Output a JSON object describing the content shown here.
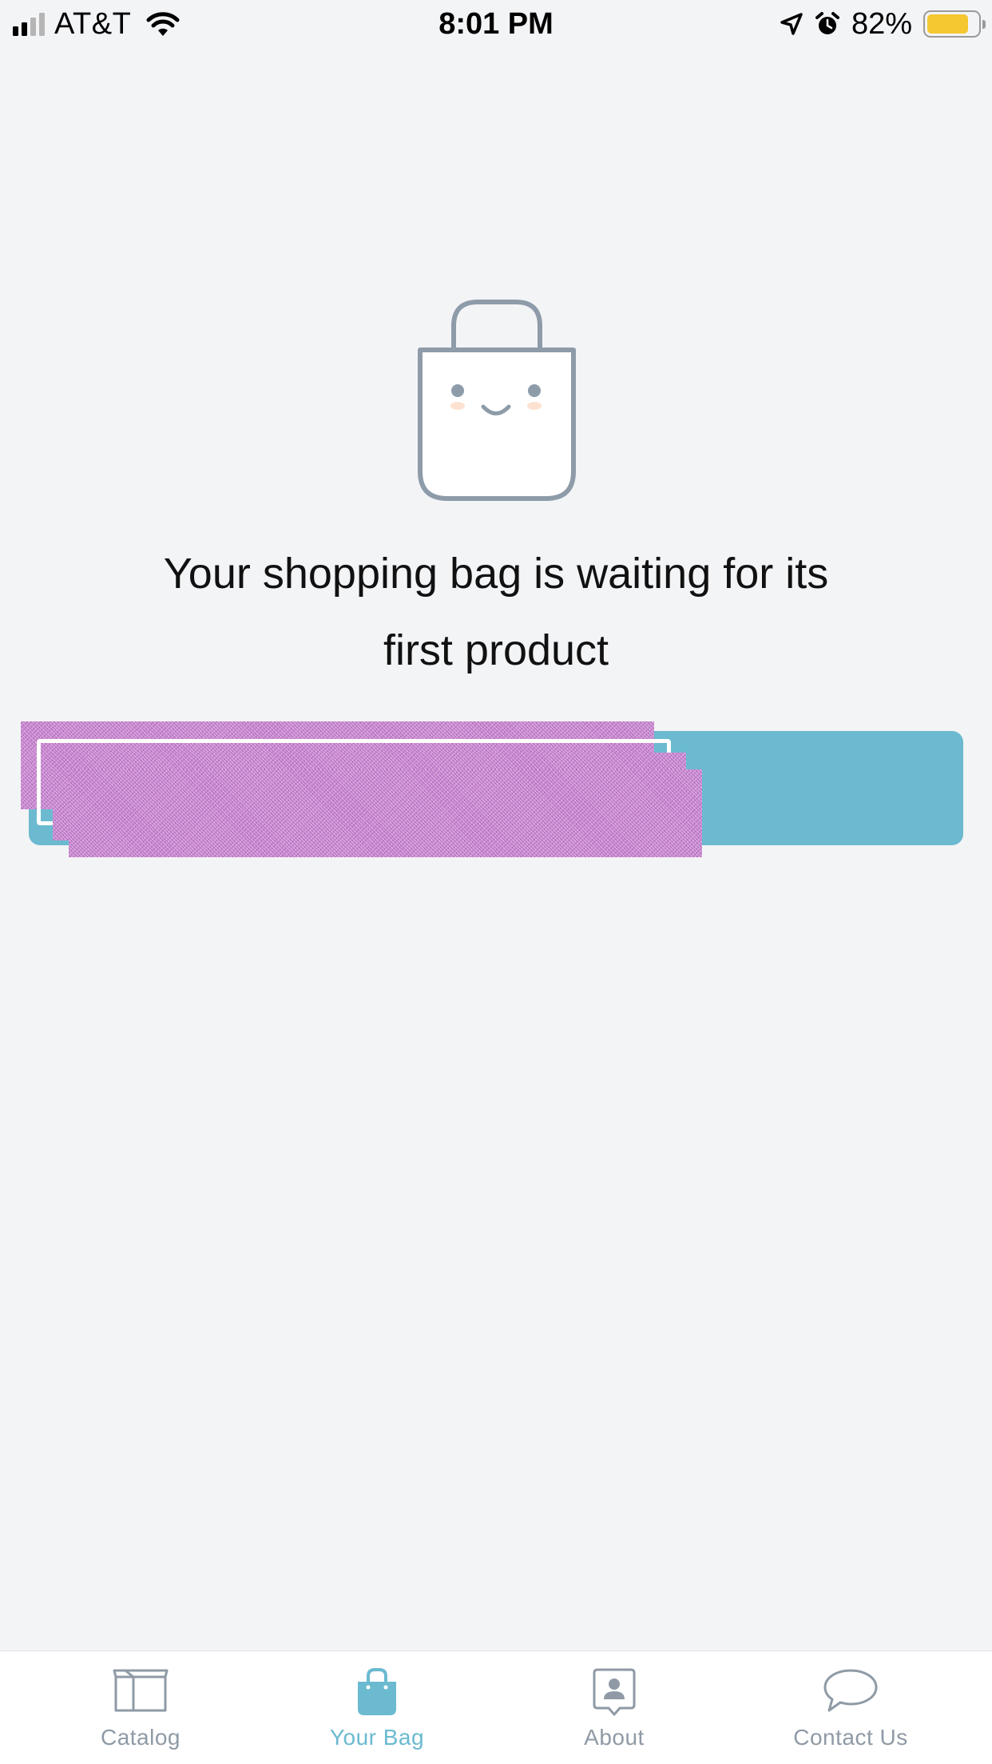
{
  "status_bar": {
    "carrier": "AT&T",
    "time": "8:01 PM",
    "battery_percent": "82%",
    "battery_level": 0.82,
    "icons": [
      "cellular-signal-icon",
      "wifi-icon",
      "location-arrow-icon",
      "alarm-icon",
      "battery-icon"
    ]
  },
  "empty_state": {
    "illustration": "smiling-shopping-bag-icon",
    "message_line1": "Your shopping bag is waiting for its",
    "message_line2": "first product"
  },
  "cta": {
    "label": "",
    "color": "#6bbad0",
    "redacted": true
  },
  "tab_bar": {
    "active_tab": "Your Bag",
    "accent_color": "#6bbad0",
    "inactive_color": "#8f9aa6",
    "tabs": [
      {
        "label": "Catalog",
        "icon": "box-icon"
      },
      {
        "label": "Your Bag",
        "icon": "shopping-bag-icon"
      },
      {
        "label": "About",
        "icon": "person-badge-icon"
      },
      {
        "label": "Contact Us",
        "icon": "speech-bubble-icon"
      }
    ]
  },
  "colors": {
    "background": "#f3f4f6",
    "text": "#111111",
    "illustration_stroke": "#8e9ba9",
    "battery_fill": "#f5c731"
  }
}
